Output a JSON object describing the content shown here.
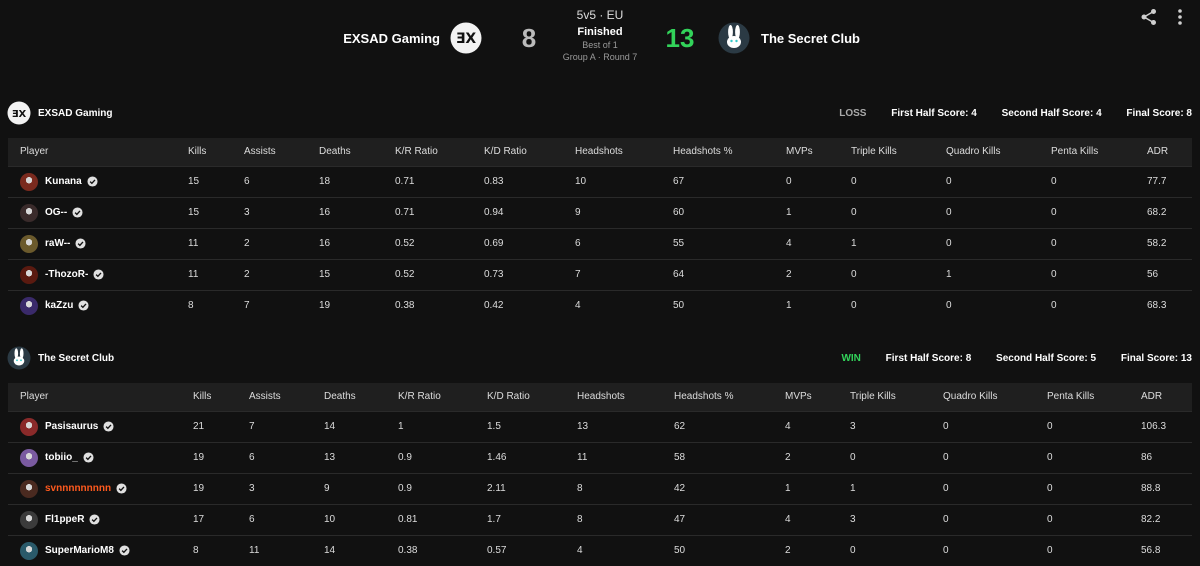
{
  "match": {
    "format": "5v5 · EU",
    "status": "Finished",
    "best_of": "Best of 1",
    "round": "Group A · Round 7",
    "team_a": {
      "name": "EXSAD Gaming",
      "score": "8"
    },
    "team_b": {
      "name": "The Secret Club",
      "score": "13"
    }
  },
  "icons": {
    "share": "share-icon",
    "more": "more-vertical-icon",
    "verified": "verified-check-icon"
  },
  "colors": {
    "win": "#32d35a",
    "loss": "#aaaaaa",
    "premium_name": "#ff5a1e",
    "background": "#111111"
  },
  "columns": [
    "Player",
    "Kills",
    "Assists",
    "Deaths",
    "K/R Ratio",
    "K/D Ratio",
    "Headshots",
    "Headshots %",
    "MVPs",
    "Triple Kills",
    "Quadro Kills",
    "Penta Kills",
    "ADR"
  ],
  "teams": [
    {
      "name": "EXSAD Gaming",
      "result": "LOSS",
      "first_half": "First Half Score: 4",
      "second_half": "Second Half Score: 4",
      "final": "Final Score: 8",
      "players": [
        {
          "name": "Kunana",
          "stats": [
            "15",
            "6",
            "18",
            "0.71",
            "0.83",
            "10",
            "67",
            "0",
            "0",
            "0",
            "0",
            "77.7"
          ]
        },
        {
          "name": "OG--",
          "stats": [
            "15",
            "3",
            "16",
            "0.71",
            "0.94",
            "9",
            "60",
            "1",
            "0",
            "0",
            "0",
            "68.2"
          ]
        },
        {
          "name": "raW--",
          "stats": [
            "11",
            "2",
            "16",
            "0.52",
            "0.69",
            "6",
            "55",
            "4",
            "1",
            "0",
            "0",
            "58.2"
          ]
        },
        {
          "name": "-ThozoR-",
          "stats": [
            "11",
            "2",
            "15",
            "0.52",
            "0.73",
            "7",
            "64",
            "2",
            "0",
            "1",
            "0",
            "56"
          ]
        },
        {
          "name": "kaZzu",
          "stats": [
            "8",
            "7",
            "19",
            "0.38",
            "0.42",
            "4",
            "50",
            "1",
            "0",
            "0",
            "0",
            "68.3"
          ]
        }
      ]
    },
    {
      "name": "The Secret Club",
      "result": "WIN",
      "first_half": "First Half Score: 8",
      "second_half": "Second Half Score: 5",
      "final": "Final Score: 13",
      "players": [
        {
          "name": "Pasisaurus",
          "stats": [
            "21",
            "7",
            "14",
            "1",
            "1.5",
            "13",
            "62",
            "4",
            "3",
            "0",
            "0",
            "106.3"
          ]
        },
        {
          "name": "tobiio_",
          "stats": [
            "19",
            "6",
            "13",
            "0.9",
            "1.46",
            "11",
            "58",
            "2",
            "0",
            "0",
            "0",
            "86"
          ]
        },
        {
          "name": "svnnnnnnnnn",
          "stats": [
            "19",
            "3",
            "9",
            "0.9",
            "2.11",
            "8",
            "42",
            "1",
            "1",
            "0",
            "0",
            "88.8"
          ]
        },
        {
          "name": "Fl1ppeR",
          "stats": [
            "17",
            "6",
            "10",
            "0.81",
            "1.7",
            "8",
            "47",
            "4",
            "3",
            "0",
            "0",
            "82.2"
          ]
        },
        {
          "name": "SuperMarioM8",
          "stats": [
            "8",
            "11",
            "14",
            "0.38",
            "0.57",
            "4",
            "50",
            "2",
            "0",
            "0",
            "0",
            "56.8"
          ]
        }
      ]
    }
  ]
}
